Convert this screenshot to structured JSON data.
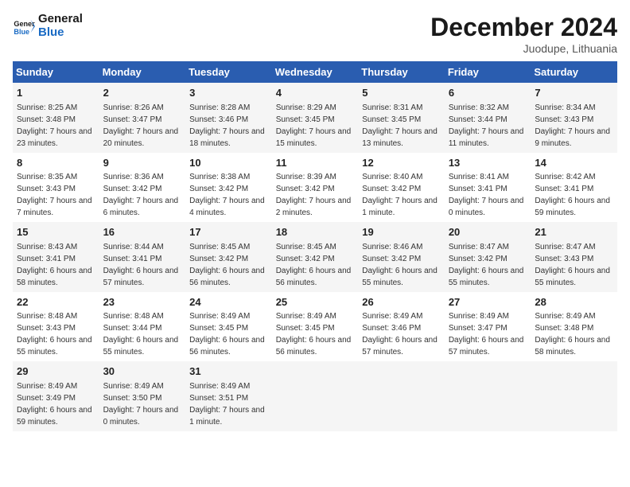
{
  "header": {
    "logo_general": "General",
    "logo_blue": "Blue",
    "month_title": "December 2024",
    "location": "Juodupe, Lithuania"
  },
  "weekdays": [
    "Sunday",
    "Monday",
    "Tuesday",
    "Wednesday",
    "Thursday",
    "Friday",
    "Saturday"
  ],
  "rows": [
    [
      {
        "day": "1",
        "sunrise": "Sunrise: 8:25 AM",
        "sunset": "Sunset: 3:48 PM",
        "daylight": "Daylight: 7 hours and 23 minutes."
      },
      {
        "day": "2",
        "sunrise": "Sunrise: 8:26 AM",
        "sunset": "Sunset: 3:47 PM",
        "daylight": "Daylight: 7 hours and 20 minutes."
      },
      {
        "day": "3",
        "sunrise": "Sunrise: 8:28 AM",
        "sunset": "Sunset: 3:46 PM",
        "daylight": "Daylight: 7 hours and 18 minutes."
      },
      {
        "day": "4",
        "sunrise": "Sunrise: 8:29 AM",
        "sunset": "Sunset: 3:45 PM",
        "daylight": "Daylight: 7 hours and 15 minutes."
      },
      {
        "day": "5",
        "sunrise": "Sunrise: 8:31 AM",
        "sunset": "Sunset: 3:45 PM",
        "daylight": "Daylight: 7 hours and 13 minutes."
      },
      {
        "day": "6",
        "sunrise": "Sunrise: 8:32 AM",
        "sunset": "Sunset: 3:44 PM",
        "daylight": "Daylight: 7 hours and 11 minutes."
      },
      {
        "day": "7",
        "sunrise": "Sunrise: 8:34 AM",
        "sunset": "Sunset: 3:43 PM",
        "daylight": "Daylight: 7 hours and 9 minutes."
      }
    ],
    [
      {
        "day": "8",
        "sunrise": "Sunrise: 8:35 AM",
        "sunset": "Sunset: 3:43 PM",
        "daylight": "Daylight: 7 hours and 7 minutes."
      },
      {
        "day": "9",
        "sunrise": "Sunrise: 8:36 AM",
        "sunset": "Sunset: 3:42 PM",
        "daylight": "Daylight: 7 hours and 6 minutes."
      },
      {
        "day": "10",
        "sunrise": "Sunrise: 8:38 AM",
        "sunset": "Sunset: 3:42 PM",
        "daylight": "Daylight: 7 hours and 4 minutes."
      },
      {
        "day": "11",
        "sunrise": "Sunrise: 8:39 AM",
        "sunset": "Sunset: 3:42 PM",
        "daylight": "Daylight: 7 hours and 2 minutes."
      },
      {
        "day": "12",
        "sunrise": "Sunrise: 8:40 AM",
        "sunset": "Sunset: 3:42 PM",
        "daylight": "Daylight: 7 hours and 1 minute."
      },
      {
        "day": "13",
        "sunrise": "Sunrise: 8:41 AM",
        "sunset": "Sunset: 3:41 PM",
        "daylight": "Daylight: 7 hours and 0 minutes."
      },
      {
        "day": "14",
        "sunrise": "Sunrise: 8:42 AM",
        "sunset": "Sunset: 3:41 PM",
        "daylight": "Daylight: 6 hours and 59 minutes."
      }
    ],
    [
      {
        "day": "15",
        "sunrise": "Sunrise: 8:43 AM",
        "sunset": "Sunset: 3:41 PM",
        "daylight": "Daylight: 6 hours and 58 minutes."
      },
      {
        "day": "16",
        "sunrise": "Sunrise: 8:44 AM",
        "sunset": "Sunset: 3:41 PM",
        "daylight": "Daylight: 6 hours and 57 minutes."
      },
      {
        "day": "17",
        "sunrise": "Sunrise: 8:45 AM",
        "sunset": "Sunset: 3:42 PM",
        "daylight": "Daylight: 6 hours and 56 minutes."
      },
      {
        "day": "18",
        "sunrise": "Sunrise: 8:45 AM",
        "sunset": "Sunset: 3:42 PM",
        "daylight": "Daylight: 6 hours and 56 minutes."
      },
      {
        "day": "19",
        "sunrise": "Sunrise: 8:46 AM",
        "sunset": "Sunset: 3:42 PM",
        "daylight": "Daylight: 6 hours and 55 minutes."
      },
      {
        "day": "20",
        "sunrise": "Sunrise: 8:47 AM",
        "sunset": "Sunset: 3:42 PM",
        "daylight": "Daylight: 6 hours and 55 minutes."
      },
      {
        "day": "21",
        "sunrise": "Sunrise: 8:47 AM",
        "sunset": "Sunset: 3:43 PM",
        "daylight": "Daylight: 6 hours and 55 minutes."
      }
    ],
    [
      {
        "day": "22",
        "sunrise": "Sunrise: 8:48 AM",
        "sunset": "Sunset: 3:43 PM",
        "daylight": "Daylight: 6 hours and 55 minutes."
      },
      {
        "day": "23",
        "sunrise": "Sunrise: 8:48 AM",
        "sunset": "Sunset: 3:44 PM",
        "daylight": "Daylight: 6 hours and 55 minutes."
      },
      {
        "day": "24",
        "sunrise": "Sunrise: 8:49 AM",
        "sunset": "Sunset: 3:45 PM",
        "daylight": "Daylight: 6 hours and 56 minutes."
      },
      {
        "day": "25",
        "sunrise": "Sunrise: 8:49 AM",
        "sunset": "Sunset: 3:45 PM",
        "daylight": "Daylight: 6 hours and 56 minutes."
      },
      {
        "day": "26",
        "sunrise": "Sunrise: 8:49 AM",
        "sunset": "Sunset: 3:46 PM",
        "daylight": "Daylight: 6 hours and 57 minutes."
      },
      {
        "day": "27",
        "sunrise": "Sunrise: 8:49 AM",
        "sunset": "Sunset: 3:47 PM",
        "daylight": "Daylight: 6 hours and 57 minutes."
      },
      {
        "day": "28",
        "sunrise": "Sunrise: 8:49 AM",
        "sunset": "Sunset: 3:48 PM",
        "daylight": "Daylight: 6 hours and 58 minutes."
      }
    ],
    [
      {
        "day": "29",
        "sunrise": "Sunrise: 8:49 AM",
        "sunset": "Sunset: 3:49 PM",
        "daylight": "Daylight: 6 hours and 59 minutes."
      },
      {
        "day": "30",
        "sunrise": "Sunrise: 8:49 AM",
        "sunset": "Sunset: 3:50 PM",
        "daylight": "Daylight: 7 hours and 0 minutes."
      },
      {
        "day": "31",
        "sunrise": "Sunrise: 8:49 AM",
        "sunset": "Sunset: 3:51 PM",
        "daylight": "Daylight: 7 hours and 1 minute."
      },
      null,
      null,
      null,
      null
    ]
  ]
}
